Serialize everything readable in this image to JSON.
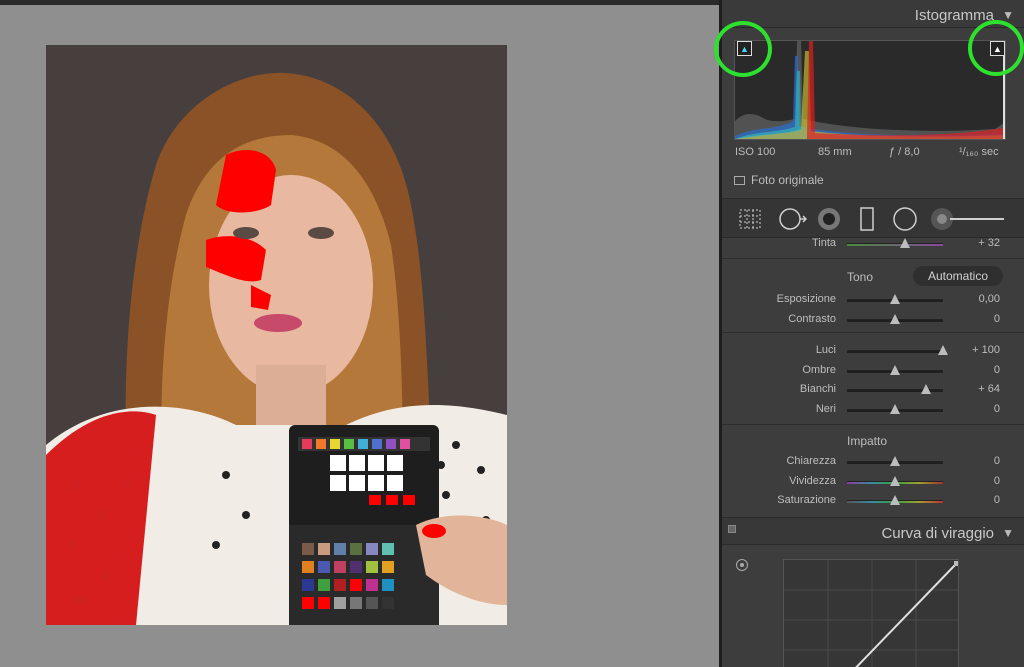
{
  "histogram_panel": {
    "title": "Istogramma",
    "collapse_icon": "triangle-down-icon",
    "shadow_clip_icon": "triangle-up-icon",
    "highlight_clip_icon": "triangle-up-icon",
    "exif": {
      "iso": "ISO 100",
      "focal": "85 mm",
      "aperture": "ƒ / 8,0",
      "shutter": "¹/₁₆₀ sec"
    },
    "original_photo_label": "Foto originale"
  },
  "tools": [
    "grid-crop-icon",
    "spot-removal-icon",
    "red-eye-icon",
    "graduated-filter-icon",
    "radial-filter-icon",
    "adjustment-brush-icon"
  ],
  "basic": {
    "tint": {
      "label": "Tinta",
      "value": "+ 32",
      "level": 0.6
    },
    "tone_label": "Tono",
    "auto_label": "Automatico",
    "sliders_a": [
      {
        "label": "Esposizione",
        "value": "0,00",
        "level": 0.5
      },
      {
        "label": "Contrasto",
        "value": "0",
        "level": 0.5
      }
    ],
    "sliders_b": [
      {
        "label": "Luci",
        "value": "+ 100",
        "level": 1.0
      },
      {
        "label": "Ombre",
        "value": "0",
        "level": 0.5
      },
      {
        "label": "Bianchi",
        "value": "+ 64",
        "level": 0.82
      },
      {
        "label": "Neri",
        "value": "0",
        "level": 0.5
      }
    ],
    "presence_label": "Impatto",
    "sliders_c": [
      {
        "label": "Chiarezza",
        "value": "0",
        "level": 0.5
      },
      {
        "label": "Vividezza",
        "value": "0",
        "level": 0.5
      },
      {
        "label": "Saturazione",
        "value": "0",
        "level": 0.5
      }
    ]
  },
  "tone_curve": {
    "title": "Curva di viraggio",
    "collapse_icon": "triangle-down-icon"
  },
  "colors": {
    "clip_ring": "#2ee12e",
    "highlight_clip": "#ff0000"
  }
}
